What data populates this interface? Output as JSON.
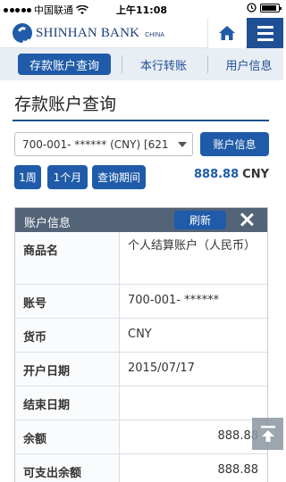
{
  "status_bar": {
    "carrier": "中国联通",
    "time": "上午11:08"
  },
  "header": {
    "logo_text": "SHINHAN BANK",
    "logo_sub": "CHINA"
  },
  "tabs": [
    {
      "label": "存款账户查询",
      "active": true
    },
    {
      "label": "本行转账",
      "active": false
    },
    {
      "label": "用户信息",
      "active": false
    }
  ],
  "page": {
    "title": "存款账户查询"
  },
  "account_select": {
    "value": "700-001- ****** (CNY) [621"
  },
  "buttons": {
    "account_info": "账户信息",
    "one_week": "1周",
    "one_month": "1个月",
    "query_period": "查询期间"
  },
  "balance": {
    "amount": "888.88",
    "currency": "CNY"
  },
  "panel": {
    "title": "账户信息",
    "refresh": "刷新",
    "rows": [
      {
        "key": "商品名",
        "value": "个人结算账户（人民币）"
      },
      {
        "key": "账号",
        "value": "700-001- ******"
      },
      {
        "key": "货币",
        "value": "CNY"
      },
      {
        "key": "开户日期",
        "value": "2015/07/17"
      },
      {
        "key": "结束日期",
        "value": ""
      },
      {
        "key": "余额",
        "value": "888.88"
      },
      {
        "key": "可支出余额",
        "value": "888.88"
      }
    ]
  },
  "colors": {
    "brand": "#1f5ba8",
    "panel_header": "#536478"
  },
  "icons": [
    "signal-dots-icon",
    "wifi-icon",
    "alarm-icon",
    "battery-icon",
    "home-icon",
    "menu-icon",
    "close-icon",
    "scroll-to-top-icon",
    "caret-down-icon",
    "logo-icon"
  ]
}
